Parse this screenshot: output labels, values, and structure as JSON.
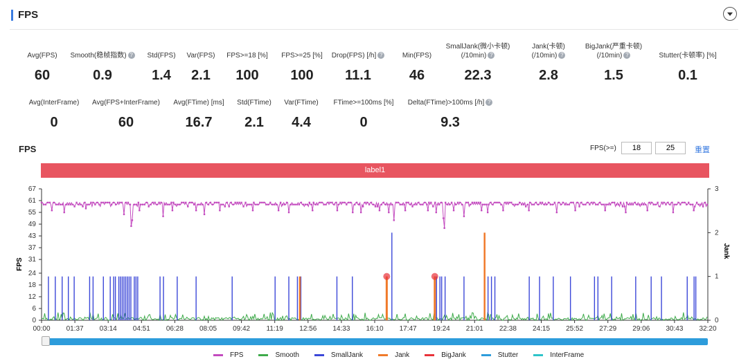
{
  "panel": {
    "title": "FPS"
  },
  "metrics_row1": [
    {
      "label": "Avg(FPS)",
      "value": "60"
    },
    {
      "label": "Smooth(稳帧指数)",
      "value": "0.9",
      "help": true
    },
    {
      "label": "Std(FPS)",
      "value": "1.4"
    },
    {
      "label": "Var(FPS)",
      "value": "2.1"
    },
    {
      "label": "FPS>=18 [%]",
      "value": "100"
    },
    {
      "label": "FPS>=25 [%]",
      "value": "100"
    },
    {
      "label": "Drop(FPS) [/h]",
      "value": "11.1",
      "help": true
    },
    {
      "label": "Min(FPS)",
      "value": "46"
    },
    {
      "label": "SmallJank(微小卡顿)",
      "label2": "(/10min)",
      "value": "22.3",
      "help": true
    },
    {
      "label": "Jank(卡顿)",
      "label2": "(/10min)",
      "value": "2.8",
      "help": true
    },
    {
      "label": "BigJank(严重卡顿)",
      "label2": "(/10min)",
      "value": "1.5",
      "help": true
    },
    {
      "label": "Stutter(卡顿率) [%]",
      "value": "0.1"
    }
  ],
  "metrics_row2": [
    {
      "label": "Avg(InterFrame)",
      "value": "0"
    },
    {
      "label": "Avg(FPS+InterFrame)",
      "value": "60"
    },
    {
      "label": "Avg(FTime) [ms]",
      "value": "16.7"
    },
    {
      "label": "Std(FTime)",
      "value": "2.1"
    },
    {
      "label": "Var(FTime)",
      "value": "4.4"
    },
    {
      "label": "FTime>=100ms [%]",
      "value": "0"
    },
    {
      "label": "Delta(FTime)>100ms [/h]",
      "value": "9.3",
      "help": true
    }
  ],
  "controls": {
    "chart_title": "FPS",
    "fps_label": "FPS(>=)",
    "threshold1": "18",
    "threshold2": "25",
    "reset": "重置"
  },
  "label_bar": "label1",
  "legend": [
    {
      "name": "FPS",
      "color": "#c34bbf"
    },
    {
      "name": "Smooth",
      "color": "#3eaa4a"
    },
    {
      "name": "SmallJank",
      "color": "#3b47d8"
    },
    {
      "name": "Jank",
      "color": "#f07a2a"
    },
    {
      "name": "BigJank",
      "color": "#e8323a"
    },
    {
      "name": "Stutter",
      "color": "#2d9cdb"
    },
    {
      "name": "InterFrame",
      "color": "#2ec4c9"
    }
  ],
  "chart_data": {
    "type": "line",
    "xlabel": "",
    "ylabel": "FPS",
    "y2label": "Jank",
    "ylim": [
      0,
      67
    ],
    "y2lim": [
      0,
      3
    ],
    "yticks": [
      0,
      6,
      12,
      18,
      24,
      31,
      37,
      43,
      49,
      55,
      61,
      67
    ],
    "y2ticks": [
      0,
      1,
      2,
      3
    ],
    "xticks": [
      "00:00",
      "01:37",
      "03:14",
      "04:51",
      "06:28",
      "08:05",
      "09:42",
      "11:19",
      "12:56",
      "14:33",
      "16:10",
      "17:47",
      "19:24",
      "21:01",
      "22:38",
      "24:15",
      "25:52",
      "27:29",
      "29:06",
      "30:43",
      "32:20"
    ],
    "xlim_seconds": [
      0,
      1940
    ],
    "series": [
      {
        "name": "FPS",
        "baseline": 59,
        "dips": [
          [
            30,
            56
          ],
          [
            65,
            55
          ],
          [
            130,
            57
          ],
          [
            240,
            54
          ],
          [
            265,
            51
          ],
          [
            262,
            48
          ],
          [
            285,
            56
          ],
          [
            355,
            53
          ],
          [
            380,
            56
          ],
          [
            450,
            56
          ],
          [
            475,
            54
          ],
          [
            520,
            56
          ],
          [
            615,
            56
          ],
          [
            690,
            56
          ],
          [
            720,
            55
          ],
          [
            790,
            56
          ],
          [
            860,
            56
          ],
          [
            905,
            55
          ],
          [
            930,
            55
          ],
          [
            985,
            56
          ],
          [
            1010,
            55
          ],
          [
            1025,
            51
          ],
          [
            1060,
            56
          ],
          [
            1125,
            56
          ],
          [
            1150,
            55
          ],
          [
            1170,
            52
          ],
          [
            1172,
            47
          ],
          [
            1200,
            56
          ],
          [
            1230,
            53
          ],
          [
            1280,
            56
          ],
          [
            1300,
            55
          ],
          [
            1345,
            56
          ],
          [
            1420,
            56
          ],
          [
            1500,
            55
          ],
          [
            1555,
            56
          ],
          [
            1640,
            56
          ],
          [
            1700,
            55
          ],
          [
            1765,
            56
          ],
          [
            1840,
            55
          ],
          [
            1900,
            56
          ]
        ]
      },
      {
        "name": "SmallJank",
        "times": [
          20,
          40,
          60,
          78,
          95,
          140,
          150,
          180,
          200,
          210,
          215,
          225,
          230,
          235,
          240,
          245,
          250,
          255,
          260,
          270,
          275,
          280,
          345,
          355,
          395,
          450,
          555,
          680,
          720,
          745,
          755,
          860,
          905,
          1020,
          1150,
          1160,
          1165,
          1175,
          1230,
          1290,
          1300,
          1310,
          1320,
          1420,
          1450,
          1490,
          1540,
          1610,
          1620,
          1660,
          1730,
          1775,
          1805,
          1880,
          1900,
          1905
        ],
        "values": [
          1,
          1,
          1,
          1,
          1,
          1,
          1,
          1,
          1,
          1,
          1,
          1,
          1,
          1,
          1,
          1,
          1,
          1,
          1,
          1,
          1,
          1,
          1,
          1,
          1,
          1,
          1,
          1,
          1,
          1,
          1,
          1,
          1,
          2,
          1,
          1,
          1,
          1,
          1,
          1,
          1,
          1,
          1,
          1,
          1,
          1,
          1,
          1,
          1,
          1,
          1,
          1,
          1,
          1,
          1,
          1
        ]
      },
      {
        "name": "Jank",
        "times": [
          752,
          1005,
          1145,
          1290
        ],
        "values": [
          1,
          1,
          1,
          2
        ]
      },
      {
        "name": "BigJank",
        "times": [
          1005,
          1145
        ],
        "values": [
          1,
          1
        ]
      },
      {
        "name": "Smooth",
        "note": "low noisy series near 0"
      }
    ]
  }
}
